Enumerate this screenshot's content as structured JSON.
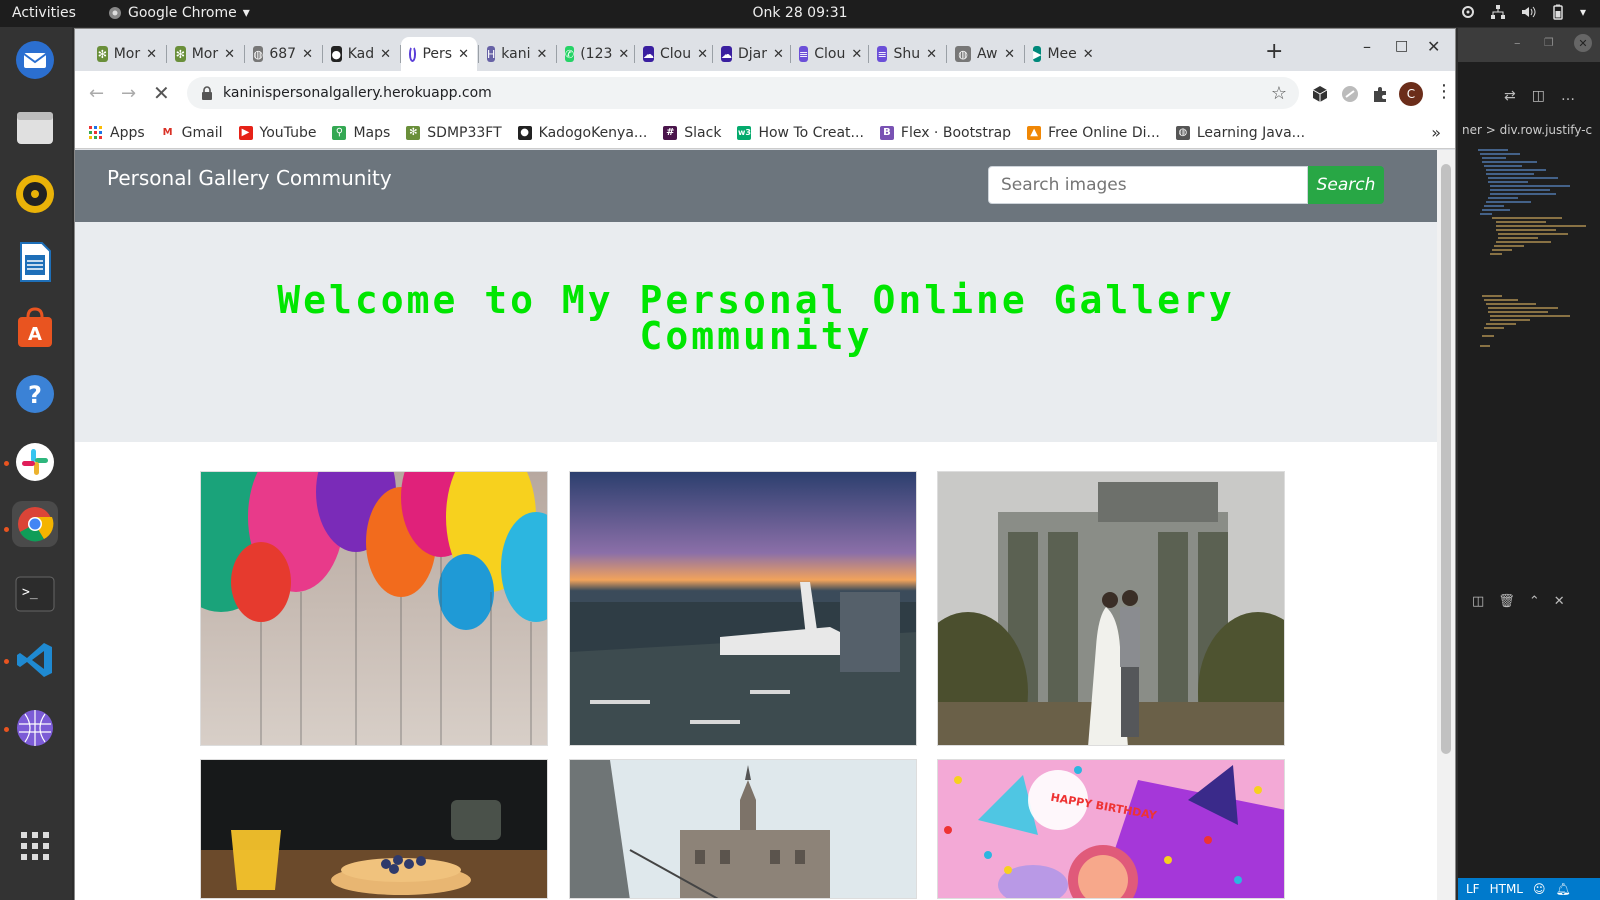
{
  "topbar": {
    "activities": "Activities",
    "app_name": "Google Chrome",
    "clock": "Onk 28  09:31"
  },
  "dock": {
    "items": [
      "thunderbird-icon",
      "files-icon",
      "rhythmbox-icon",
      "writer-icon",
      "software-icon",
      "help-icon",
      "slack-icon",
      "chrome-icon",
      "terminal-icon",
      "vscode-icon",
      "network-icon",
      "app-grid-icon"
    ]
  },
  "tabs": [
    {
      "label": "Mor",
      "favicon": "palm-icon"
    },
    {
      "label": "Mor",
      "favicon": "palm-icon"
    },
    {
      "label": "687",
      "favicon": "globe-icon"
    },
    {
      "label": "Kad",
      "favicon": "github-icon"
    },
    {
      "label": "Pers",
      "favicon": "loading-icon"
    },
    {
      "label": "kani",
      "favicon": "heroku-icon"
    },
    {
      "label": "(123",
      "favicon": "whatsapp-icon"
    },
    {
      "label": "Clou",
      "favicon": "cloud-icon"
    },
    {
      "label": "Djar",
      "favicon": "cloud-icon"
    },
    {
      "label": "Clou",
      "favicon": "doc-icon"
    },
    {
      "label": "Shu",
      "favicon": "doc-icon"
    },
    {
      "label": "Aw",
      "favicon": "globe-icon"
    },
    {
      "label": "Mee",
      "favicon": "meet-icon"
    }
  ],
  "new_tab": "+",
  "address": {
    "url": "kaninispersonalgallery.herokuapp.com",
    "profile_initial": "C"
  },
  "bookmarks": [
    {
      "label": "Apps",
      "icon": "apps-icon"
    },
    {
      "label": "Gmail",
      "icon": "gmail-icon"
    },
    {
      "label": "YouTube",
      "icon": "youtube-icon"
    },
    {
      "label": "Maps",
      "icon": "maps-icon"
    },
    {
      "label": "SDMP33FT",
      "icon": "palm-icon"
    },
    {
      "label": "KadogoKenya...",
      "icon": "github-icon"
    },
    {
      "label": "Slack",
      "icon": "slack-icon"
    },
    {
      "label": "How To Creat...",
      "icon": "w3-icon"
    },
    {
      "label": "Flex · Bootstrap",
      "icon": "bootstrap-icon"
    },
    {
      "label": "Free Online Di...",
      "icon": "drawio-icon"
    },
    {
      "label": "Learning Java...",
      "icon": "globe-icon"
    }
  ],
  "bookmarks_overflow": "»",
  "page": {
    "brand": "Personal Gallery Community",
    "search_placeholder": "Search images",
    "search_button": "Search",
    "heading": "Welcome to My Personal Online Gallery Community",
    "images": [
      {
        "name": "gallery-image-balloons"
      },
      {
        "name": "gallery-image-airplane"
      },
      {
        "name": "gallery-image-wedding"
      },
      {
        "name": "gallery-image-pancakes"
      },
      {
        "name": "gallery-image-castle"
      },
      {
        "name": "gallery-image-birthday"
      }
    ]
  },
  "editor": {
    "breadcrumb": "ner > div.row.justify-c",
    "status_lf": "LF",
    "status_lang": "HTML"
  },
  "colors": {
    "heading": "#00e600",
    "navbar": "#6c757d",
    "search_button": "#28a745",
    "jumbotron": "#e9ecef"
  }
}
